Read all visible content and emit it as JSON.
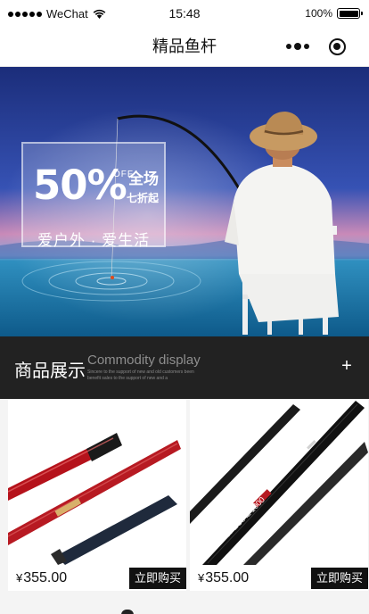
{
  "status_bar": {
    "carrier": "WeChat",
    "time": "15:48",
    "battery": "100%",
    "battery_level": 1.0
  },
  "nav": {
    "title": "精品鱼杆"
  },
  "banner": {
    "promo_percent": "50%",
    "promo_off": "OFF",
    "promo_sale_line1": "全场",
    "promo_sale_line2": "七折起",
    "promo_slogan": "爱户外 · 爱生活"
  },
  "section": {
    "title": "商品展示",
    "subtitle": "Commodity display",
    "fine_print": "Sincere to the support of new and old customers been benefit sales to the support of new and a",
    "add_label": "+"
  },
  "products": [
    {
      "currency": "¥",
      "price": "355.00",
      "buy_label": "立即购买",
      "rod_text": ""
    },
    {
      "currency": "¥",
      "price": "355.00",
      "buy_label": "立即购买",
      "rod_text": "SPECIAL 1000"
    }
  ],
  "colors": {
    "section_bg": "#222222",
    "buy_bg": "#111111",
    "rod_red": "#b5121b"
  }
}
